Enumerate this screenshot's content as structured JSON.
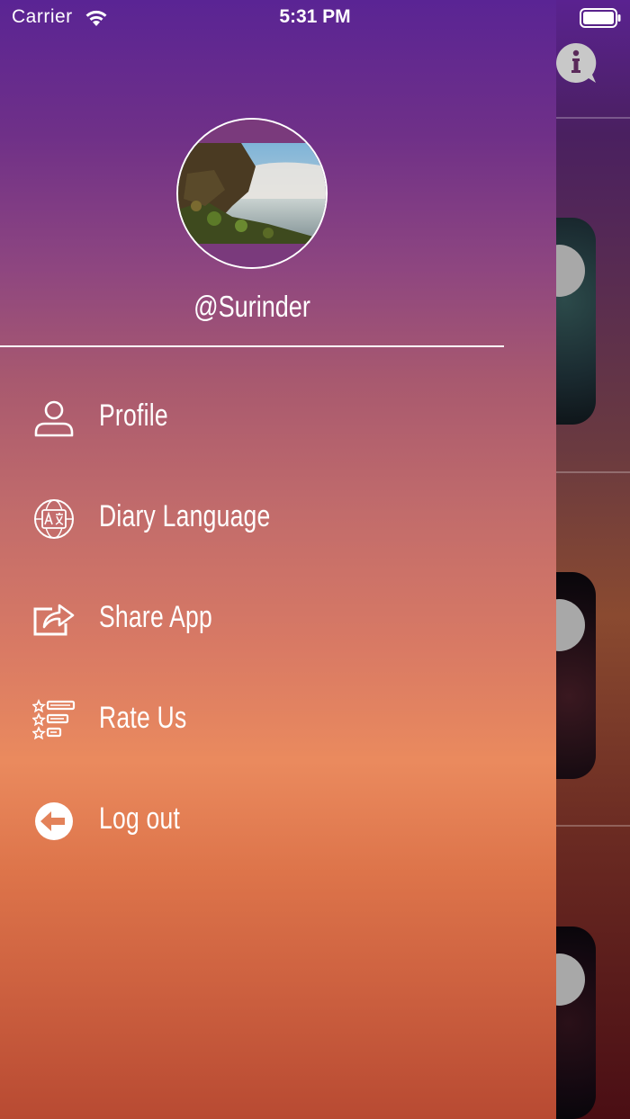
{
  "status_bar": {
    "carrier": "Carrier",
    "time": "5:31 PM"
  },
  "drawer": {
    "username": "@Surinder",
    "menu": [
      {
        "label": "Profile",
        "icon": "person-icon"
      },
      {
        "label": "Diary Language",
        "icon": "translate-globe-icon"
      },
      {
        "label": "Share App",
        "icon": "share-icon"
      },
      {
        "label": "Rate Us",
        "icon": "rate-stars-icon"
      },
      {
        "label": "Log out",
        "icon": "logout-arrow-icon"
      }
    ]
  },
  "colors": {
    "gradient_top": "#5a2494",
    "gradient_mid": "#ea8a5e",
    "gradient_bottom": "#b84a32",
    "text": "#ffffff"
  }
}
